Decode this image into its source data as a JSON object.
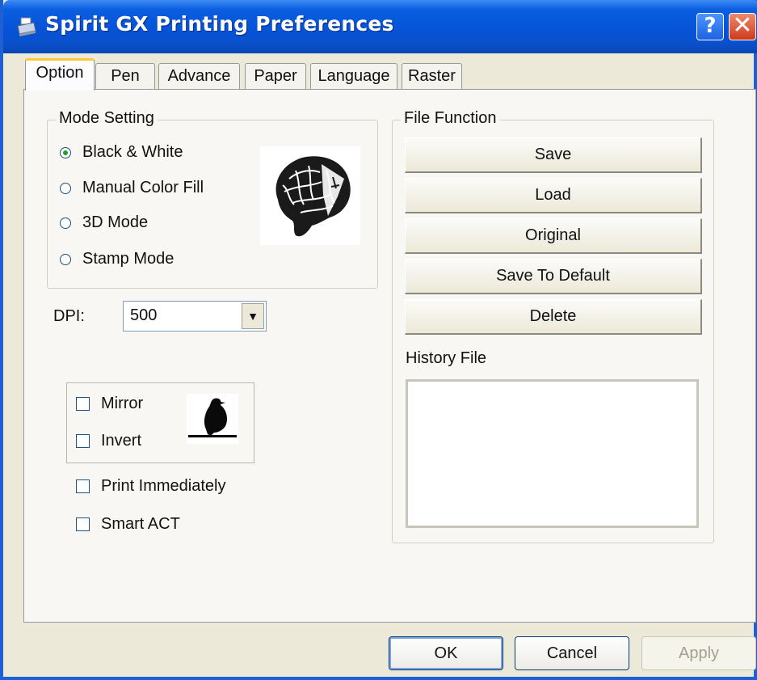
{
  "window": {
    "title": "Spirit GX Printing Preferences",
    "help_glyph": "?",
    "close_glyph": "✕"
  },
  "tabs": [
    {
      "label": "Option",
      "active": true
    },
    {
      "label": "Pen",
      "active": false
    },
    {
      "label": "Advance",
      "active": false
    },
    {
      "label": "Paper",
      "active": false
    },
    {
      "label": "Language",
      "active": false
    },
    {
      "label": "Raster",
      "active": false
    }
  ],
  "mode_setting": {
    "legend": "Mode Setting",
    "options": [
      {
        "label": "Black & White",
        "checked": true
      },
      {
        "label": "Manual Color Fill",
        "checked": false
      },
      {
        "label": "3D Mode",
        "checked": false
      },
      {
        "label": "Stamp Mode",
        "checked": false
      }
    ],
    "preview_icon": "brain-preview-icon"
  },
  "dpi": {
    "label": "DPI:",
    "value": "500",
    "arrow": "▼"
  },
  "flip_group": {
    "mirror_label": "Mirror",
    "mirror_checked": false,
    "invert_label": "Invert",
    "invert_checked": false,
    "preview_icon": "bird-preview-icon"
  },
  "print_immediately": {
    "label": "Print Immediately",
    "checked": false
  },
  "smart_act": {
    "label": "Smart ACT",
    "checked": false
  },
  "file_function": {
    "legend": "File Function",
    "buttons": [
      "Save",
      "Load",
      "Original",
      "Save To Default",
      "Delete"
    ],
    "history_label": "History File",
    "history_items": []
  },
  "footer": {
    "ok": "OK",
    "cancel": "Cancel",
    "apply": "Apply"
  },
  "colors": {
    "titlebar": "#0653d8",
    "dialog_bg": "#ece9d8",
    "panel_bg": "#f8f7f3",
    "active_tab_accent": "#ffc83c"
  }
}
